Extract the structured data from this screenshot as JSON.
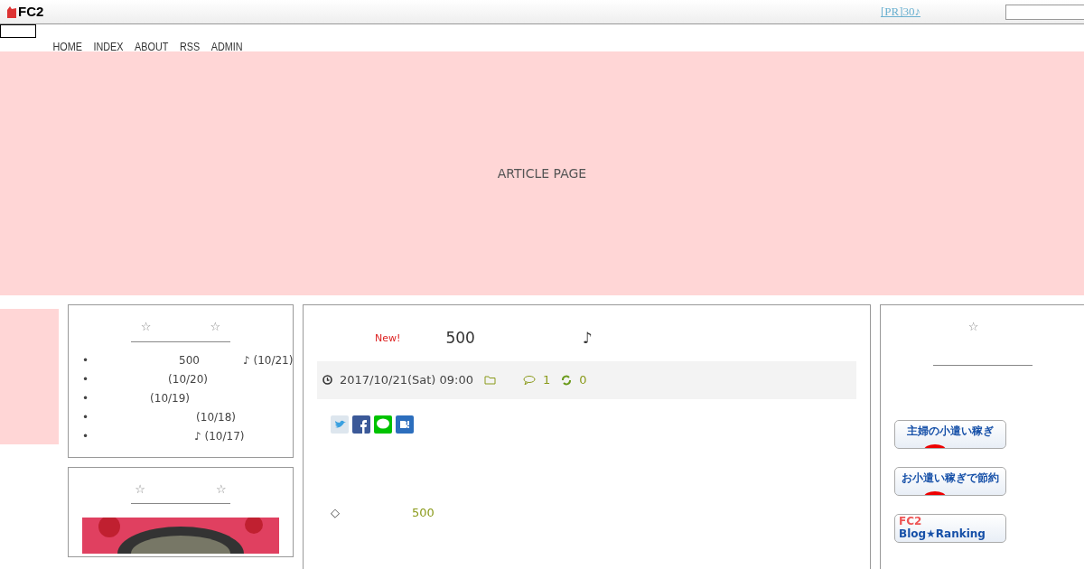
{
  "topbar": {
    "logo": "FC2",
    "pr_link": "[PR]30♪"
  },
  "nav": [
    "HOME",
    "INDEX",
    "ABOUT",
    "RSS",
    "ADMIN"
  ],
  "hero": {
    "title": "ARTICLE PAGE"
  },
  "recent_posts": {
    "title": "☆　　　　　☆",
    "marker": "•",
    "items": [
      {
        "text": "500　　　　♪ (10/21)"
      },
      {
        "text": "(10/20)"
      },
      {
        "text": "(10/19)"
      },
      {
        "text": "(10/18)"
      },
      {
        "text": "♪ (10/17)"
      }
    ]
  },
  "profile": {
    "title": "☆　　　　　　☆"
  },
  "article": {
    "badge": "New!",
    "title": "500　　　　　　　♪",
    "date": "2017/10/21(Sat) 09:00",
    "comments": "1",
    "trackbacks": "0",
    "body_mark": "◇",
    "body_link": "500"
  },
  "right": {
    "title": "☆",
    "banners": [
      {
        "kind": "jp",
        "text": "主婦の小遣い稼ぎ"
      },
      {
        "kind": "jp",
        "text": "お小遣い稼ぎで節約"
      },
      {
        "kind": "rank",
        "text": "FC2",
        "text_2": "Blog★Ranking"
      }
    ]
  }
}
